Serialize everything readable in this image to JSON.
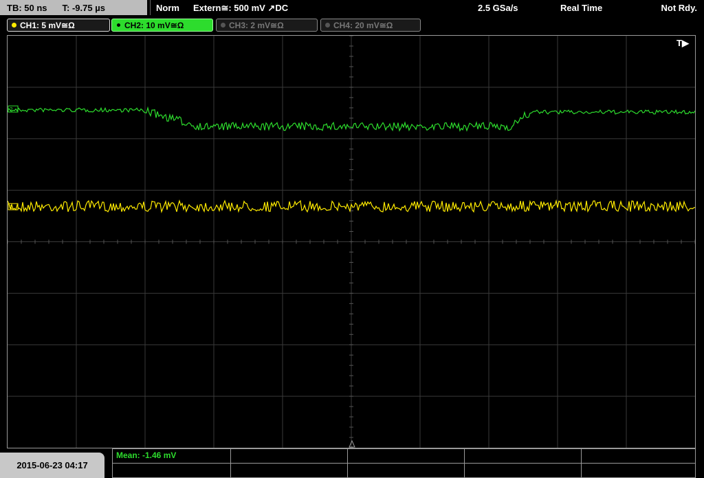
{
  "status": {
    "timebase": "TB: 50 ns",
    "trigger_time": "T: -9.75 µs",
    "mode": "Norm",
    "trigger_source": "Extern≅: 500 mV ↗DC",
    "sample_rate": "2.5 GSa/s",
    "acquisition": "Real Time",
    "state": "Not Rdy."
  },
  "channels": [
    {
      "label": "CH1: 5 mV≅Ω",
      "color": "#ffeb00"
    },
    {
      "label": "CH2: 10 mV≅Ω",
      "color": "#2ddc2d"
    },
    {
      "label": "CH3: 2 mV≅Ω",
      "color": "#777777"
    },
    {
      "label": "CH4: 20 mV≅Ω",
      "color": "#777777"
    }
  ],
  "trigger_marker": "T▶",
  "measurement": {
    "mean": "Mean: -1.46 mV"
  },
  "datetime": "2015-06-23 04:17",
  "colors": {
    "ch1": "#ffeb00",
    "ch2": "#2ddc2d",
    "grid": "#3a3a3a"
  }
}
